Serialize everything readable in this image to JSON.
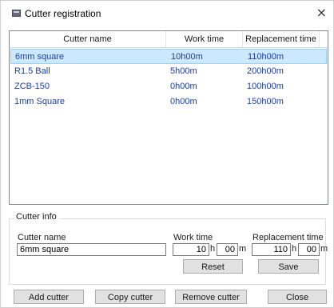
{
  "window": {
    "title": "Cutter registration",
    "close_glyph": "×"
  },
  "list": {
    "columns": [
      "Cutter name",
      "Work time",
      "Replacement time"
    ],
    "rows": [
      {
        "name": "6mm square",
        "work": "10h00m",
        "replacement": "110h00m",
        "selected": true
      },
      {
        "name": "R1.5 Ball",
        "work": "5h00m",
        "replacement": "200h00m",
        "selected": false
      },
      {
        "name": "ZCB-150",
        "work": "0h00m",
        "replacement": "100h00m",
        "selected": false
      },
      {
        "name": "1mm Square",
        "work": "0h00m",
        "replacement": "150h00m",
        "selected": false
      }
    ]
  },
  "cutter_info": {
    "group_label": "Cutter info",
    "name_label": "Cutter name",
    "name_value": "6mm square",
    "work_label": "Work time",
    "work_hours": "10",
    "work_minutes": "00",
    "replacement_label": "Replacement time",
    "replacement_hours": "110",
    "replacement_minutes": "00",
    "unit_h": "h",
    "unit_m": "m",
    "reset_label": "Reset",
    "save_label": "Save"
  },
  "footer": {
    "add_label": "Add cutter",
    "copy_label": "Copy cutter",
    "remove_label": "Remove cutter",
    "close_label": "Close"
  },
  "colors": {
    "selection": "#cce8ff",
    "row_text": "#1e3da8"
  },
  "icons": {
    "app": "window-icon",
    "close": "close-icon"
  }
}
